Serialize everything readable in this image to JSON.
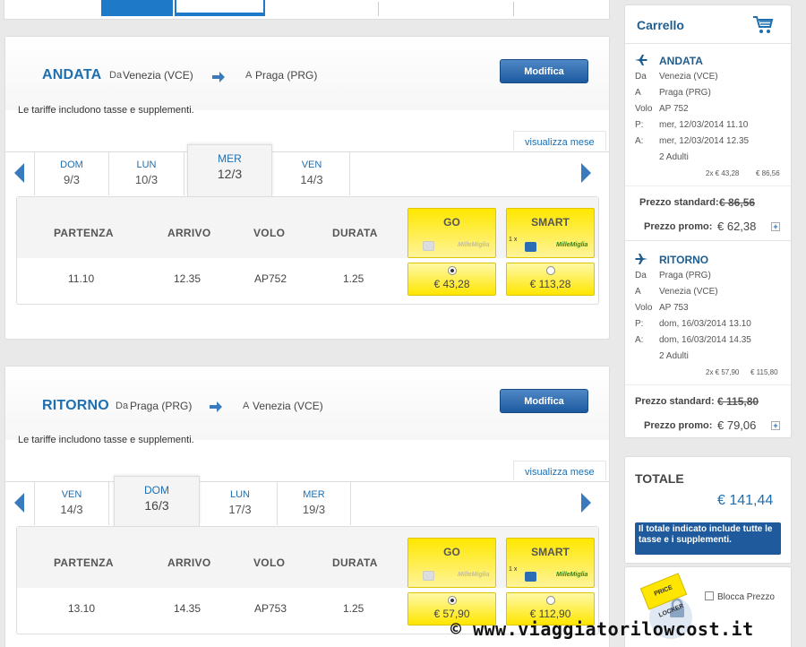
{
  "outbound": {
    "direction": "ANDATA",
    "from_label": "Da",
    "from_city": "Venezia (VCE)",
    "to_label": "A",
    "to_city": "Praga (PRG)",
    "modify": "Modifica",
    "note": "Le tariffe includono tasse e supplementi.",
    "view_month": "visualizza mese",
    "days": [
      {
        "name": "DOM",
        "date": "9/3"
      },
      {
        "name": "LUN",
        "date": "10/3"
      },
      {
        "name": "MER",
        "date": "12/3"
      },
      {
        "name": "VEN",
        "date": "14/3"
      }
    ],
    "headers": {
      "departure": "PARTENZA",
      "arrival": "ARRIVO",
      "flight": "VOLO",
      "duration": "DURATA"
    },
    "fares": {
      "go": "GO",
      "smart": "SMART",
      "qty": "1 x",
      "brand": "MilleMiglia"
    },
    "row": {
      "departure": "11.10",
      "arrival": "12.35",
      "flight": "AP752",
      "duration": "1.25",
      "go_price": "€ 43,28",
      "smart_price": "€ 113,28"
    }
  },
  "return": {
    "direction": "RITORNO",
    "from_label": "Da",
    "from_city": "Praga (PRG)",
    "to_label": "A",
    "to_city": "Venezia (VCE)",
    "modify": "Modifica",
    "note": "Le tariffe includono tasse e supplementi.",
    "view_month": "visualizza mese",
    "days": [
      {
        "name": "VEN",
        "date": "14/3"
      },
      {
        "name": "DOM",
        "date": "16/3"
      },
      {
        "name": "LUN",
        "date": "17/3"
      },
      {
        "name": "MER",
        "date": "19/3"
      }
    ],
    "headers": {
      "departure": "PARTENZA",
      "arrival": "ARRIVO",
      "flight": "VOLO",
      "duration": "DURATA"
    },
    "fares": {
      "go": "GO",
      "smart": "SMART",
      "qty": "1 x",
      "brand": "MilleMiglia"
    },
    "row": {
      "departure": "13.10",
      "arrival": "14.35",
      "flight": "AP753",
      "duration": "1.25",
      "go_price": "€ 57,90",
      "smart_price": "€ 112,90"
    }
  },
  "cart": {
    "title": "Carrello",
    "outbound": {
      "title": "ANDATA",
      "da_label": "Da",
      "da": "Venezia (VCE)",
      "a_label": "A",
      "a": "Praga (PRG)",
      "volo_label": "Volo",
      "volo": "AP 752",
      "p_label": "P:",
      "p": "mer, 12/03/2014 11.10",
      "arr_label": "A:",
      "arr": "mer, 12/03/2014 12.35",
      "pax": "2 Adulti",
      "calc": "2x € 43,28",
      "calc_total": "€ 86,56",
      "std_label": "Prezzo standard:",
      "std": "€ 86,56",
      "promo_label": "Prezzo promo:",
      "promo": "€ 62,38"
    },
    "return": {
      "title": "RITORNO",
      "da_label": "Da",
      "da": "Praga (PRG)",
      "a_label": "A",
      "a": "Venezia (VCE)",
      "volo_label": "Volo",
      "volo": "AP 753",
      "p_label": "P:",
      "p": "dom, 16/03/2014 13.10",
      "arr_label": "A:",
      "arr": "dom, 16/03/2014 14.35",
      "pax": "2 Adulti",
      "calc": "2x € 57,90",
      "calc_total": "€ 115,80",
      "std_label": "Prezzo standard:",
      "std": "€ 115,80",
      "promo_label": "Prezzo promo:",
      "promo": "€ 79,06"
    },
    "total_label": "TOTALE",
    "total": "€ 141,44",
    "total_note": "Il totale indicato include tutte le tasse e i supplementi.",
    "price_locker": "PRICE LOCKER",
    "lock_label": "Blocca Prezzo"
  },
  "watermark": "www.viaggiatorilowcost.it",
  "watermark_symbol": "©",
  "colors": {
    "accent": "#1f6fb0",
    "fare_yellow": "#ffe700",
    "button_blue": "#1d5aa0"
  }
}
